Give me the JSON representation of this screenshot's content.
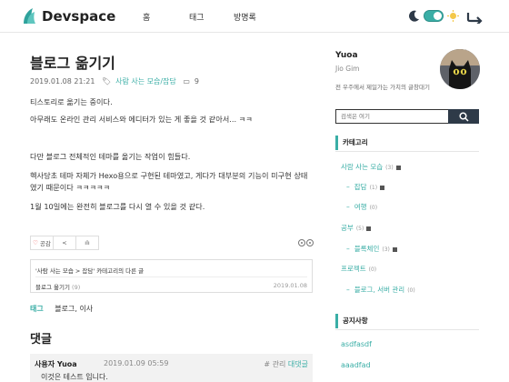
{
  "header": {
    "site_name": "Devspace",
    "nav": [
      "홈",
      "태그",
      "방명록"
    ]
  },
  "post": {
    "title": "블로그 옮기기",
    "date": "2019.01.08 21:21",
    "category": "사람 사는 모습/잡담",
    "comment_count": "9",
    "paragraphs": [
      "티스토리로 옮기는 중이다.",
      "아무래도 온라인 관리 서비스와 에디터가 있는 게 좋을 것 같아서... ㅋㅋ",
      "다만 블로그 전체적인 테마를 옮기는 작업이 힘들다.",
      "헥사당초 테마 자체가 Hexo용으로 구현된 테마였고, 게다가 대부분의 기능이 미구현 상태였기 때문이다 ㅋㅋㅋㅋㅋ",
      "1월 10일에는 완전히 블로그를 다시 열 수 있을 것 같다."
    ],
    "like_label": "공감"
  },
  "related": {
    "heading": "'사람 사는 모습 > 잡담' 카테고리의 다른 글",
    "item_title": "블로그 옮기기",
    "item_count": "(9)",
    "item_date": "2019.01.08"
  },
  "tags": {
    "label": "태그",
    "value": "블로그, 이사"
  },
  "comments": {
    "title": "댓글",
    "author": "사용자 Yuoa",
    "date": "2019.01.09 05:59",
    "manage": "# 관리",
    "reply": "대댓글",
    "text": "이것은 테스트 입니다."
  },
  "sidebar": {
    "profile_name": "Yuoa",
    "profile_sub": "Jio Gim",
    "profile_desc": "전 우주에서 제일가는 가치의 글창대기",
    "search_placeholder": "검색은 여기",
    "categories_title": "카테고리",
    "categories": [
      {
        "label": "사람 사는 모습",
        "count": "(3)",
        "level": 0
      },
      {
        "label": "잡담",
        "count": "(1)",
        "level": 1
      },
      {
        "label": "여행",
        "count": "(0)",
        "level": 1
      },
      {
        "label": "공부",
        "count": "(5)",
        "level": 0
      },
      {
        "label": "블록체인",
        "count": "(3)",
        "level": 1
      },
      {
        "label": "프로젝트",
        "count": "(0)",
        "level": 0
      },
      {
        "label": "블로그, 서버 관리",
        "count": "(0)",
        "level": 1
      }
    ],
    "notice_title": "공지사항",
    "notices": [
      "asdfasdf",
      "aaadfad"
    ]
  },
  "colors": {
    "accent": "#3aaea6",
    "dark": "#2e3a48"
  }
}
